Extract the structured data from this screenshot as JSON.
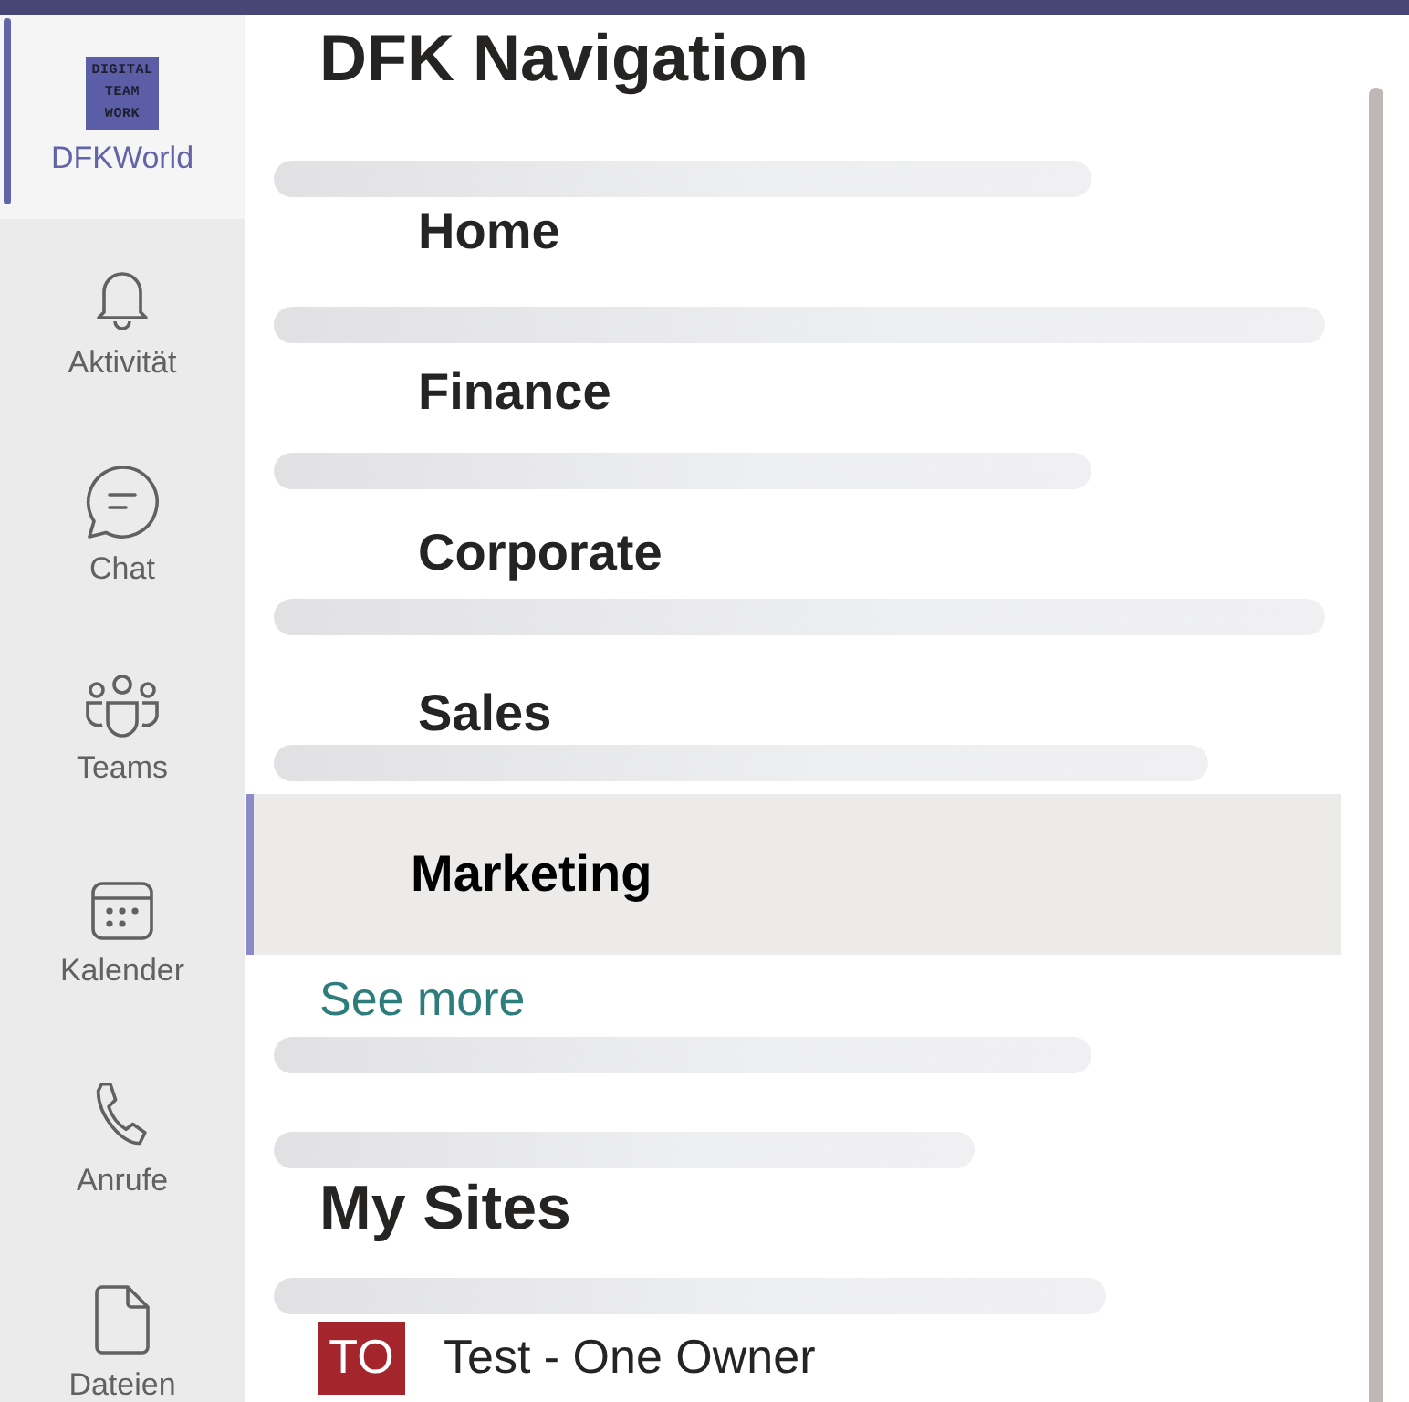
{
  "rail": [
    {
      "kind": "logo",
      "logo_lines": [
        "DIGITAL",
        "TEAM",
        "WORK"
      ],
      "label": "DFKWorld",
      "selected": true
    },
    {
      "kind": "bell",
      "label": "Aktivität",
      "selected": false
    },
    {
      "kind": "chat",
      "label": "Chat",
      "selected": false
    },
    {
      "kind": "teams",
      "label": "Teams",
      "selected": false
    },
    {
      "kind": "calendar",
      "label": "Kalender",
      "selected": false
    },
    {
      "kind": "phone",
      "label": "Anrufe",
      "selected": false
    },
    {
      "kind": "file",
      "label": "Dateien",
      "selected": false
    }
  ],
  "main": {
    "title": "DFK Navigation",
    "nav_items": [
      {
        "label": "Home",
        "selected": false
      },
      {
        "label": "Finance",
        "selected": false
      },
      {
        "label": "Corporate",
        "selected": false
      },
      {
        "label": "Sales",
        "selected": false
      },
      {
        "label": "Marketing",
        "selected": true
      }
    ],
    "see_more": "See more",
    "my_sites": {
      "title": "My Sites",
      "sites": [
        {
          "initials": "TO",
          "name": "Test - One Owner",
          "color": "#a4262c"
        }
      ]
    },
    "loading": true
  }
}
